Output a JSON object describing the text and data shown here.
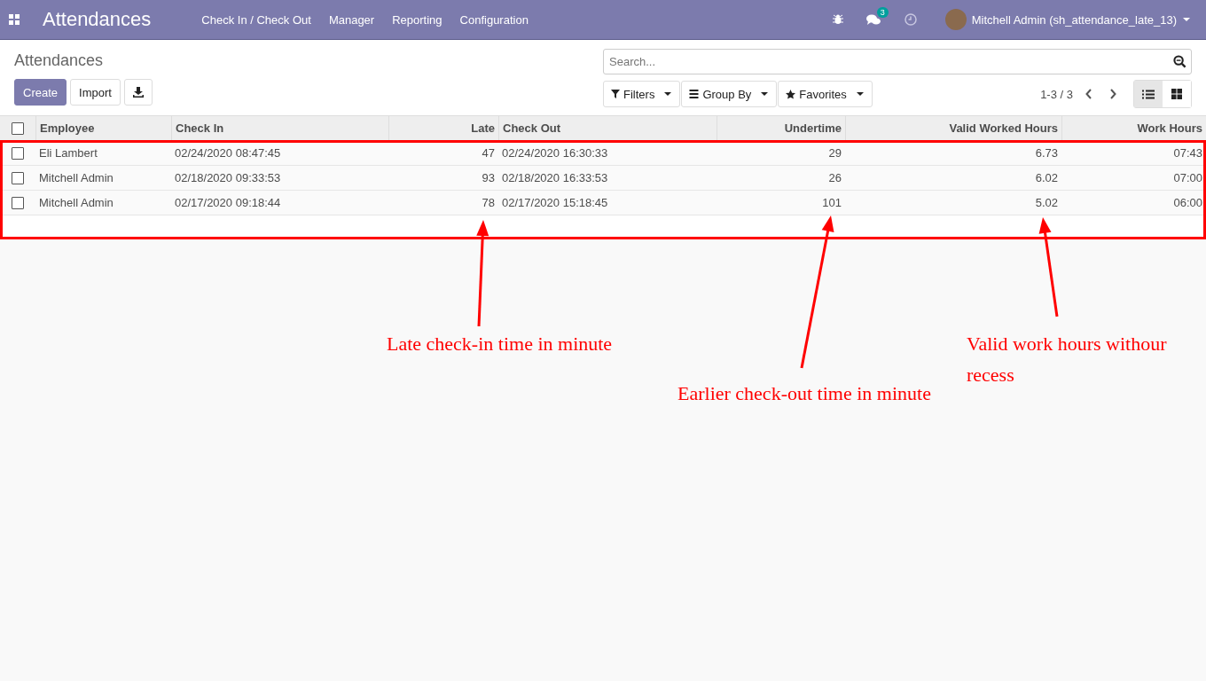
{
  "navbar": {
    "app_title": "Attendances",
    "menu": [
      "Check In / Check Out",
      "Manager",
      "Reporting",
      "Configuration"
    ],
    "messages_badge": "3",
    "user": "Mitchell Admin (sh_attendance_late_13)"
  },
  "control_panel": {
    "breadcrumb": "Attendances",
    "buttons": [
      "Create",
      "Import"
    ],
    "search": {
      "placeholder": "Search..."
    },
    "filters": [
      "Filters",
      "Group By",
      "Favorites"
    ],
    "pager": "1-3 / 3",
    "views": [
      {
        "kind": "list",
        "selected": true
      },
      {
        "kind": "kanban",
        "selected": false
      }
    ]
  },
  "table": {
    "select_all": {
      "checked": false
    },
    "columns": [
      "Employee",
      "Check In",
      "Late",
      "Check Out",
      "Undertime",
      "Valid Worked Hours",
      "Work Hours"
    ],
    "rows": [
      {
        "checked": false,
        "cells": [
          "Eli Lambert",
          "02/24/2020 08:47:45",
          "47",
          "02/24/2020 16:30:33",
          "29",
          "6.73",
          "07:43"
        ]
      },
      {
        "checked": false,
        "cells": [
          "Mitchell Admin",
          "02/18/2020 09:33:53",
          "93",
          "02/18/2020 16:33:53",
          "26",
          "6.02",
          "07:00"
        ]
      },
      {
        "checked": false,
        "cells": [
          "Mitchell Admin",
          "02/17/2020 09:18:44",
          "78",
          "02/17/2020 15:18:45",
          "101",
          "5.02",
          "06:00"
        ]
      }
    ]
  },
  "annotations": [
    "Late check-in time in minute",
    "Earlier check-out time in minute",
    "Valid work hours withour recess"
  ]
}
